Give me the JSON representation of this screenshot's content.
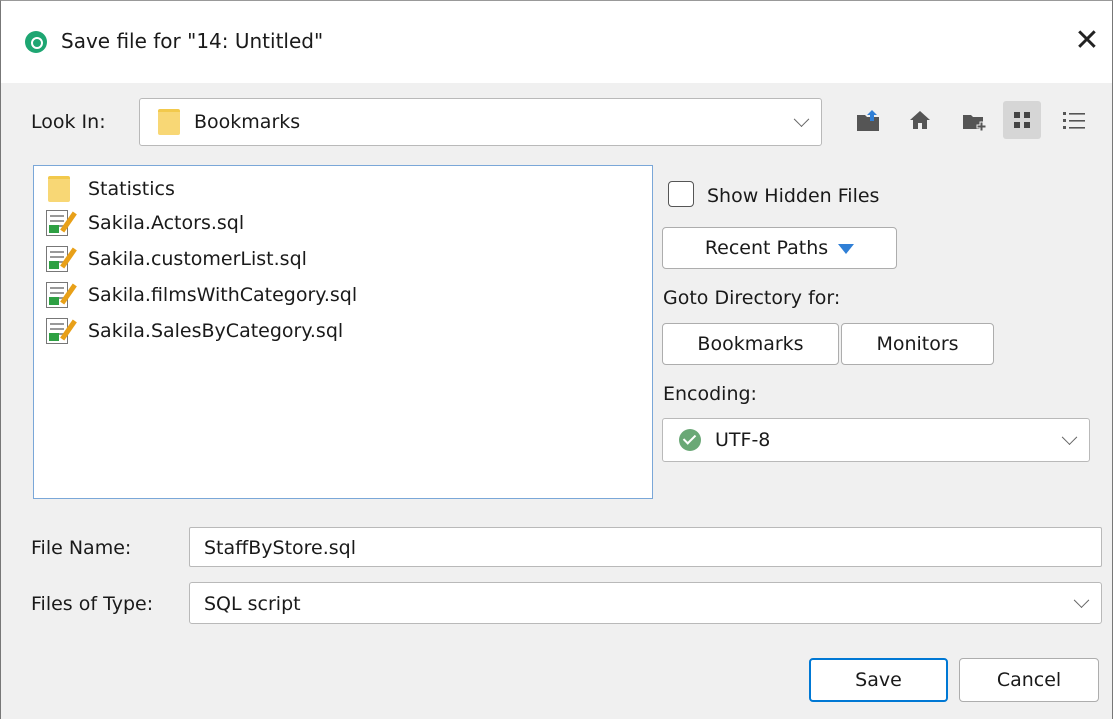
{
  "window": {
    "title": "Save file for \"14: Untitled\"",
    "close_glyph": "✕"
  },
  "lookin": {
    "label": "Look In:",
    "value": "Bookmarks"
  },
  "toolbar": {
    "icons": [
      "up-folder-icon",
      "home-icon",
      "new-folder-icon",
      "grid-view-icon",
      "list-view-icon"
    ]
  },
  "files": [
    {
      "name": "Statistics",
      "type": "folder"
    },
    {
      "name": "Sakila.Actors.sql",
      "type": "sql"
    },
    {
      "name": "Sakila.customerList.sql",
      "type": "sql"
    },
    {
      "name": "Sakila.filmsWithCategory.sql",
      "type": "sql"
    },
    {
      "name": "Sakila.SalesByCategory.sql",
      "type": "sql"
    }
  ],
  "options": {
    "show_hidden_label": "Show Hidden Files",
    "show_hidden_checked": false,
    "recent_paths_label": "Recent Paths",
    "goto_label": "Goto Directory for:",
    "goto_bookmarks": "Bookmarks",
    "goto_monitors": "Monitors",
    "encoding_label": "Encoding:",
    "encoding_value": "UTF-8"
  },
  "filename": {
    "label": "File Name:",
    "value": "StaffByStore.sql"
  },
  "filetype": {
    "label": "Files of Type:",
    "value": "SQL script"
  },
  "buttons": {
    "save": "Save",
    "cancel": "Cancel"
  },
  "colors": {
    "accent": "#0078d4",
    "folder": "#f8d775",
    "ok": "#6aa876",
    "app": "#1ea672"
  }
}
